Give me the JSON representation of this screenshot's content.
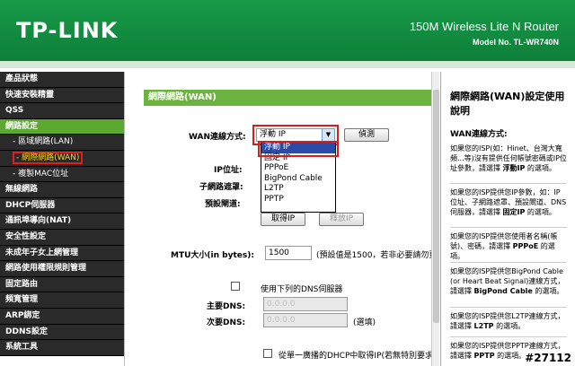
{
  "header": {
    "logo": "TP-LINK",
    "product": "150M Wireless Lite N Router",
    "model": "Model No. TL-WR740N"
  },
  "sidebar": {
    "items": [
      {
        "label": "產品狀態"
      },
      {
        "label": "快速安裝精靈"
      },
      {
        "label": "QSS"
      },
      {
        "label": "網路設定"
      },
      {
        "label": "- 區域網路(LAN)"
      },
      {
        "label": "- 網際網路(WAN)"
      },
      {
        "label": "- 複製MAC位址"
      },
      {
        "label": "無線網路"
      },
      {
        "label": "DHCP伺服器"
      },
      {
        "label": "通訊埠導向(NAT)"
      },
      {
        "label": "安全性設定"
      },
      {
        "label": "未成年子女上網管理"
      },
      {
        "label": "網路使用權限規則管理"
      },
      {
        "label": "固定路由"
      },
      {
        "label": "頻寬管理"
      },
      {
        "label": "ARP綁定"
      },
      {
        "label": "DDNS設定"
      },
      {
        "label": "系統工具"
      }
    ]
  },
  "main": {
    "title": "網際網路(WAN)",
    "wan_type_label": "WAN連線方式:",
    "wan_type_value": "浮動 IP",
    "detect_button": "偵測",
    "dropdown_options": [
      "浮動 IP",
      "固定 IP",
      "PPPoE",
      "BigPond Cable",
      "L2TP",
      "PPTP"
    ],
    "ip_label": "IP位址:",
    "subnet_label": "子網路遮罩:",
    "gateway_label": "預設閘道:",
    "get_ip_button": "取得IP",
    "release_ip_button": "釋放IP",
    "mtu_label": "MTU大小(in bytes):",
    "mtu_value": "1500",
    "mtu_note": "(預設值是1500，若非必要請勿更",
    "dns_checkbox_label": "使用下列的DNS伺服器",
    "primary_dns_label": "主要DNS:",
    "secondary_dns_label": "次要DNS:",
    "dns_placeholder": "0.0.0.0",
    "secondary_dns_note": "(選填)",
    "dhcp_unicast_label": "從單一廣播的DHCP中取得IP(若無特別要求"
  },
  "help": {
    "title": "網際網路(WAN)設定使用說明",
    "subtitle": "WAN連線方式:",
    "p1_a": "如果您的ISP(如：Hinet、台灣大寬頻...等)沒有提供任何帳號密碼或IP位址參數，請選擇 ",
    "p1_b": "浮動IP",
    "p1_c": " 的選項。",
    "p2_a": "如果您的ISP提供您IP參數，如：IP位址、子網路遮罩、預設閘道、DNS伺服器，請選擇 ",
    "p2_b": "固定IP",
    "p2_c": " 的選項。",
    "p3_a": "如果您的ISP提供您使用者名稱(帳號)、密碼，請選擇 ",
    "p3_b": "PPPoE",
    "p3_c": " 的選項。",
    "p4_a": "如果您的ISP提供您BigPond Cable (or Heart Beat Signal)連線方式，請選擇 ",
    "p4_b": "BigPond Cable",
    "p4_c": " 的選項。",
    "p5_a": "如果您的ISP提供您L2TP連線方式，請選擇 ",
    "p5_b": "L2TP",
    "p5_c": " 的選項。",
    "p6_a": "如果您的ISP提供您PPTP連線方式，請選擇 ",
    "p6_b": "PPTP",
    "p6_c": " 的選項。"
  },
  "watermark": "#27112",
  "colors": {
    "header_green": "#179a48",
    "sidebar_dark": "#2a2a2a",
    "sidebar_active": "#5ca930",
    "title_bar": "#6cb33f",
    "highlight_red": "#d81d1d",
    "selected_option": "#2b4ba8"
  }
}
